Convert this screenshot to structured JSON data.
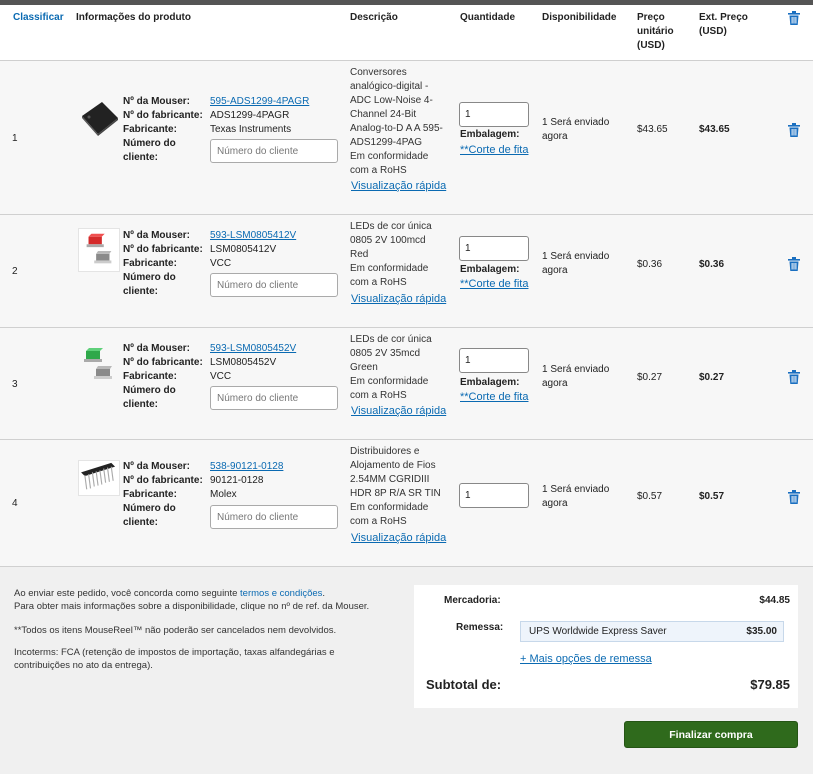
{
  "header": {
    "sort": "Classificar",
    "product_info": "Informações do produto",
    "description": "Descrição",
    "quantity": "Quantidade",
    "availability": "Disponibilidade",
    "unit_price": [
      "Preço",
      "unitário",
      "(USD)"
    ],
    "ext_price": [
      "Ext. Preço",
      "(USD)"
    ]
  },
  "labels": {
    "mouser_no": "Nº da Mouser:",
    "mfr_no": "Nº do fabricante:",
    "mfr": "Fabricante:",
    "cust_no": [
      "Número do",
      "cliente:"
    ],
    "cust_placeholder": "Número do cliente",
    "packaging": "Embalagem:",
    "cut_tape": "**Corte de fita",
    "quick_view": "Visualização rápida",
    "rohs": [
      "Em conformidade",
      "com a RoHS"
    ]
  },
  "items": [
    {
      "index": "1",
      "mouser_no": "595-ADS1299-4PAGR",
      "mfr_no": "ADS1299-4PAGR",
      "mfr": "Texas Instruments",
      "desc": [
        "Conversores",
        "analógico-digital -",
        "ADC Low-Noise 4-",
        "Channel 24-Bit",
        "Analog-to-D A A 595-",
        "ADS1299-4PAG"
      ],
      "qty": "1",
      "availability": [
        "1 Será enviado",
        "agora"
      ],
      "unit_price": "$43.65",
      "ext_price": "$43.65",
      "image": "chip-ic-image"
    },
    {
      "index": "2",
      "mouser_no": "593-LSM0805412V",
      "mfr_no": "LSM0805412V",
      "mfr": "VCC",
      "desc": [
        "LEDs de cor única",
        "0805 2V 100mcd",
        "Red"
      ],
      "qty": "1",
      "availability": [
        "1 Será enviado",
        "agora"
      ],
      "unit_price": "$0.36",
      "ext_price": "$0.36",
      "image": "red-led-image"
    },
    {
      "index": "3",
      "mouser_no": "593-LSM0805452V",
      "mfr_no": "LSM0805452V",
      "mfr": "VCC",
      "desc": [
        "LEDs de cor única",
        "0805 2V 35mcd",
        "Green"
      ],
      "qty": "1",
      "availability": [
        "1 Será enviado",
        "agora"
      ],
      "unit_price": "$0.27",
      "ext_price": "$0.27",
      "image": "green-led-image"
    },
    {
      "index": "4",
      "mouser_no": "538-90121-0128",
      "mfr_no": "90121-0128",
      "mfr": "Molex",
      "desc": [
        "Distribuidores e",
        "Alojamento de Fios",
        "2.54MM CGRIDIII",
        "HDR 8P R/A SR TIN"
      ],
      "qty": "1",
      "availability": [
        "1 Será enviado",
        "agora"
      ],
      "unit_price": "$0.57",
      "ext_price": "$0.57",
      "image": "pin-header-image"
    }
  ],
  "footer": {
    "terms_prefix": "Ao enviar este pedido, você concorda como seguinte ",
    "terms_link": "termos e condições",
    "terms_suffix": ".",
    "availability_note": "Para obter mais informações sobre a disponibilidade, clique no nº de ref. da Mouser.",
    "mousereel_note": "**Todos os itens MouseReel™ não poderão ser cancelados nem devolvidos.",
    "incoterms_1": "Incoterms: FCA (retenção de impostos de importação, taxas alfandegárias e",
    "incoterms_2": "contribuições no ato da entrega)."
  },
  "summary": {
    "merch_label": "Mercadoria:",
    "merch_value": "$44.85",
    "ship_label": "Remessa:",
    "ship_method": "UPS Worldwide Express Saver",
    "ship_price": "$35.00",
    "more_options": "+ Mais opções de remessa",
    "subtotal_label": "Subtotal de:",
    "subtotal_value": "$79.85"
  },
  "checkout_label": "Finalizar compra",
  "colors": {
    "link": "#0a6ab2",
    "checkout": "#2f6a1c",
    "trash": "#1a6fc0"
  }
}
